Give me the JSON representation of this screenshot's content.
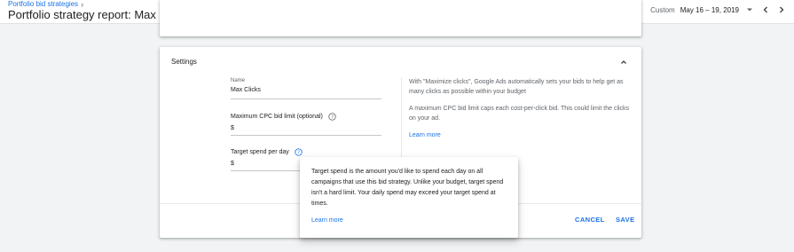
{
  "header": {
    "breadcrumb": "Portfolio bid strategies",
    "breadcrumb_sep": "›",
    "title": "Portfolio strategy report: Max Clicks (Maximize clicks)",
    "date_prefix": "Custom",
    "date_range": "May 16 – 19, 2019",
    "icons": [
      "dropdown-arrow-icon",
      "chevron-left-icon",
      "chevron-right-icon"
    ]
  },
  "settings": {
    "title": "Settings",
    "name_label": "Name",
    "name_value": "Max Clicks",
    "max_cpc_label": "Maximum CPC bid limit (optional)",
    "max_cpc_currency": "$",
    "target_spend_label": "Target spend per day",
    "target_spend_currency": "$",
    "info_paragraph_1": "With \"Maximize clicks\", Google Ads automatically sets your bids to help get as many clicks as possible within your budget",
    "info_paragraph_2": "A maximum CPC bid limit caps each cost-per-click bid. This could limit the clicks on your ad.",
    "learn_more": "Learn more",
    "cancel_label": "CANCEL",
    "save_label": "SAVE"
  },
  "tooltip": {
    "text": "Target spend is the amount you'd like to spend each day on all campaigns that use this bid strategy. Unlike your budget, target spend isn't a hard limit. Your daily spend may exceed your target spend at times.",
    "learn_more": "Learn more"
  },
  "colors": {
    "accent": "#1a73e8",
    "background": "#f1f3f4"
  }
}
